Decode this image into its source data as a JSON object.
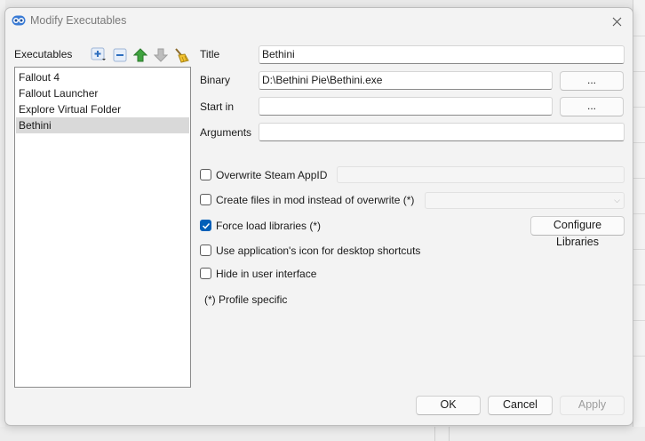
{
  "window": {
    "title": "Modify Executables"
  },
  "executables": {
    "label": "Executables",
    "items": [
      "Fallout 4",
      "Fallout Launcher",
      "Explore Virtual Folder",
      "Bethini"
    ],
    "selected": "Bethini"
  },
  "form": {
    "title_label": "Title",
    "title_value": "Bethini",
    "binary_label": "Binary",
    "binary_value": "D:\\Bethini Pie\\Bethini.exe",
    "binary_browse": "...",
    "startin_label": "Start in",
    "startin_value": "",
    "startin_browse": "...",
    "arguments_label": "Arguments",
    "arguments_value": ""
  },
  "options": {
    "overwrite_appid": {
      "label": "Overwrite Steam AppID",
      "checked": false
    },
    "create_files": {
      "label": "Create files in mod instead of overwrite (*)",
      "checked": false
    },
    "force_load": {
      "label": "Force load libraries (*)",
      "checked": true
    },
    "use_icon": {
      "label": "Use application's icon for desktop shortcuts",
      "checked": false
    },
    "hide_ui": {
      "label": "Hide in user interface",
      "checked": false
    },
    "configure_libraries": "Configure Libraries",
    "profile_note": "(*) Profile specific"
  },
  "buttons": {
    "ok": "OK",
    "cancel": "Cancel",
    "apply": "Apply"
  },
  "colors": {
    "accent": "#005fb8",
    "add": "#2f6fbf",
    "up": "#3fa33f",
    "down": "#9e9e9e"
  },
  "icons": [
    "app-icon",
    "close-icon",
    "add-icon",
    "remove-icon",
    "move-up-icon",
    "move-down-icon",
    "clear-icon",
    "checkmark-icon",
    "chevron-down-icon"
  ]
}
